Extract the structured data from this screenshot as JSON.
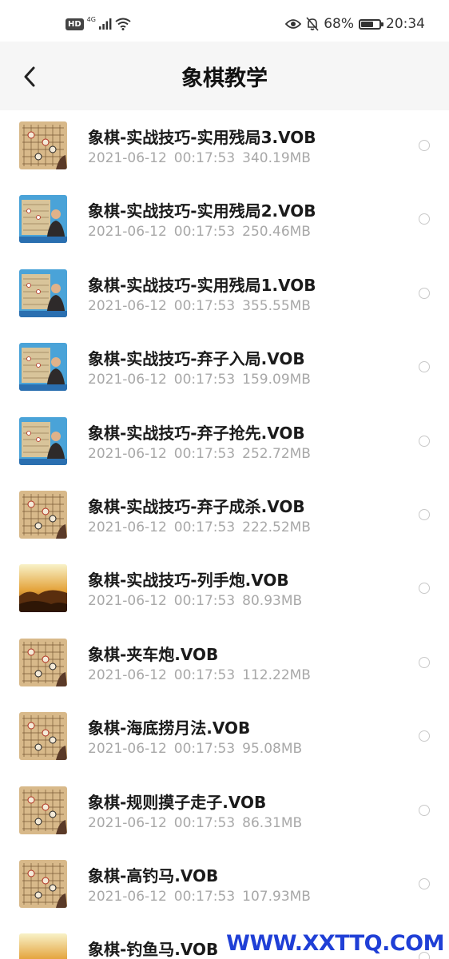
{
  "status_bar": {
    "hd": "HD",
    "network": "4G",
    "battery": "68%",
    "battery_level": 0.68,
    "time": "20:34"
  },
  "header": {
    "title": "象棋教学"
  },
  "files": [
    {
      "name": "象棋-实战技巧-实用残局3.VOB",
      "date": "2021-06-12",
      "duration": "00:17:53",
      "size": "340.19MB",
      "thumb": "board"
    },
    {
      "name": "象棋-实战技巧-实用残局2.VOB",
      "date": "2021-06-12",
      "duration": "00:17:53",
      "size": "250.46MB",
      "thumb": "teacher"
    },
    {
      "name": "象棋-实战技巧-实用残局1.VOB",
      "date": "2021-06-12",
      "duration": "00:17:53",
      "size": "355.55MB",
      "thumb": "teacher"
    },
    {
      "name": "象棋-实战技巧-弃子入局.VOB",
      "date": "2021-06-12",
      "duration": "00:17:53",
      "size": "159.09MB",
      "thumb": "teacher"
    },
    {
      "name": "象棋-实战技巧-弃子抢先.VOB",
      "date": "2021-06-12",
      "duration": "00:17:53",
      "size": "252.72MB",
      "thumb": "teacher"
    },
    {
      "name": "象棋-实战技巧-弃子成杀.VOB",
      "date": "2021-06-12",
      "duration": "00:17:53",
      "size": "222.52MB",
      "thumb": "board"
    },
    {
      "name": "象棋-实战技巧-列手炮.VOB",
      "date": "2021-06-12",
      "duration": "00:17:53",
      "size": "80.93MB",
      "thumb": "landscape"
    },
    {
      "name": "象棋-夹车炮.VOB",
      "date": "2021-06-12",
      "duration": "00:17:53",
      "size": "112.22MB",
      "thumb": "board"
    },
    {
      "name": "象棋-海底捞月法.VOB",
      "date": "2021-06-12",
      "duration": "00:17:53",
      "size": "95.08MB",
      "thumb": "board"
    },
    {
      "name": "象棋-规则摸子走子.VOB",
      "date": "2021-06-12",
      "duration": "00:17:53",
      "size": "86.31MB",
      "thumb": "board"
    },
    {
      "name": "象棋-高钓马.VOB",
      "date": "2021-06-12",
      "duration": "00:17:53",
      "size": "107.93MB",
      "thumb": "board"
    },
    {
      "name": "象棋-钓鱼马.VOB",
      "date": "2021-06-12",
      "duration": "",
      "size": "",
      "thumb": "landscape"
    }
  ],
  "watermark": "WWW.XXTTQ.COM",
  "colors": {
    "header_bg": "#f6f6f6",
    "title": "#111111",
    "meta": "#a8a8a8",
    "watermark": "#1f3fd6"
  }
}
